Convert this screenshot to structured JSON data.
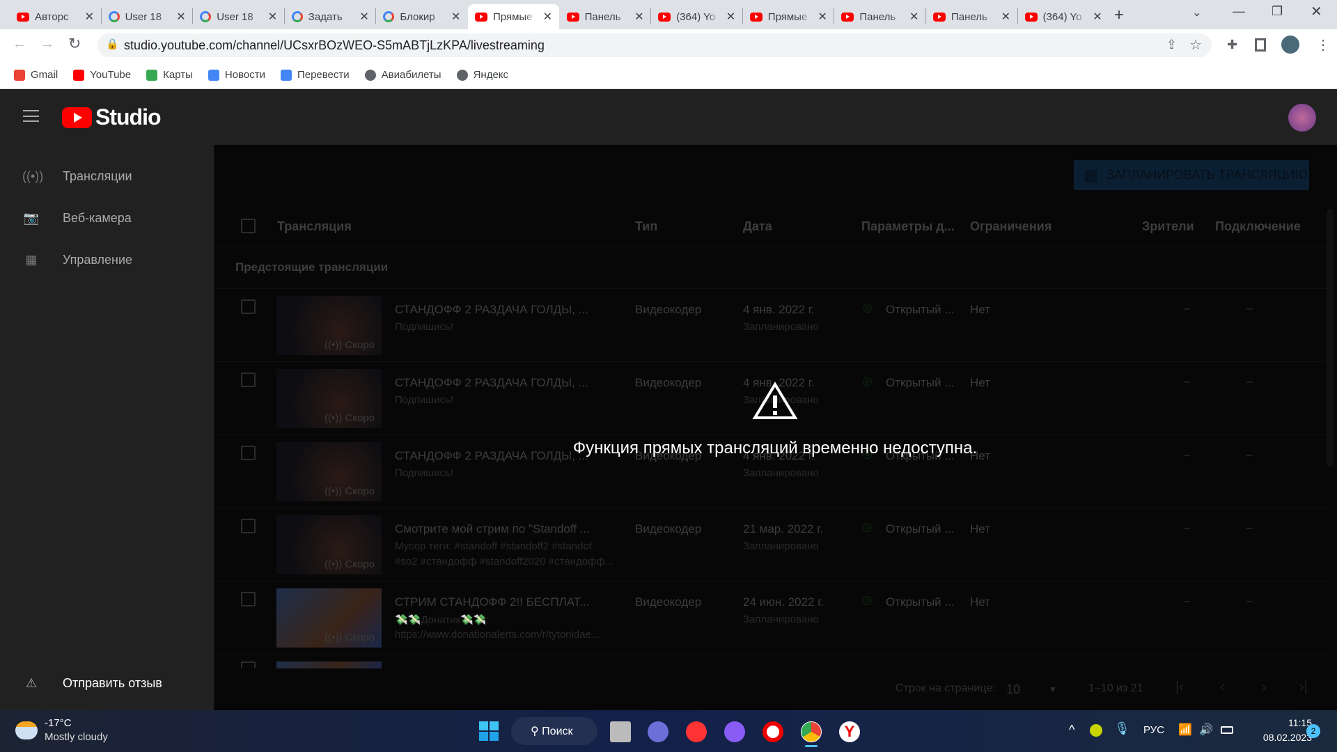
{
  "browser": {
    "tabs": [
      {
        "label": "Авторс",
        "icon": "youtube"
      },
      {
        "label": "User 18",
        "icon": "google"
      },
      {
        "label": "User 18",
        "icon": "google"
      },
      {
        "label": "Задать",
        "icon": "google"
      },
      {
        "label": "Блокир",
        "icon": "google"
      },
      {
        "label": "Прямые",
        "icon": "youtube",
        "active": true
      },
      {
        "label": "Панель",
        "icon": "youtube"
      },
      {
        "label": "(364) Yo",
        "icon": "youtube"
      },
      {
        "label": "Прямые",
        "icon": "youtube"
      },
      {
        "label": "Панель",
        "icon": "youtube"
      },
      {
        "label": "Панель",
        "icon": "youtube"
      },
      {
        "label": "(364) Yo",
        "icon": "youtube"
      }
    ],
    "url": "studio.youtube.com/channel/UCsxrBOzWEO-S5mABTjLzKPA/livestreaming",
    "bookmarks": [
      "Gmail",
      "YouTube",
      "Карты",
      "Новости",
      "Перевести",
      "Авиабилеты",
      "Яндекс"
    ]
  },
  "studio": {
    "logo_text": "Studio",
    "brand_color": "#ff0000"
  },
  "sidebar": {
    "items": [
      {
        "label": "Трансляции",
        "icon": "broadcast-icon"
      },
      {
        "label": "Веб-камера",
        "icon": "camera-icon"
      },
      {
        "label": "Управление",
        "icon": "calendar-icon"
      }
    ],
    "feedback": "Отправить отзыв"
  },
  "main": {
    "schedule_button": "ЗАПЛАНИРОВАТЬ ТРАНСЛЯЦИЮ",
    "columns": [
      "Трансляция",
      "Тип",
      "Дата",
      "Параметры д...",
      "Ограничения",
      "Зрители",
      "Подключение"
    ],
    "section": "Предстоящие трансляции",
    "rows": [
      {
        "title": "СТАНДОФФ 2 РАЗДАЧА ГОЛДЫ, ...",
        "desc": "Подпишись!",
        "desc2": "",
        "type": "Видеокодер",
        "date": "4 янв. 2022 г.",
        "status": "Запланировано",
        "visibility": "Открытый ...",
        "restrictions": "Нет",
        "viewers": "–",
        "connection": "–",
        "badge": "Скоро"
      },
      {
        "title": "СТАНДОФФ 2 РАЗДАЧА ГОЛДЫ, ...",
        "desc": "Подпишись!",
        "desc2": "",
        "type": "Видеокодер",
        "date": "4 янв. 2022 г.",
        "status": "Запланировано",
        "visibility": "Открытый ...",
        "restrictions": "Нет",
        "viewers": "–",
        "connection": "–",
        "badge": "Скоро"
      },
      {
        "title": "СТАНДОФФ 2 РАЗДАЧА ГОЛДЫ, ...",
        "desc": "Подпишись!",
        "desc2": "",
        "type": "Видеокодер",
        "date": "4 янв. 2022 г.",
        "status": "Запланировано",
        "visibility": "Открытый ...",
        "restrictions": "Нет",
        "viewers": "–",
        "connection": "–",
        "badge": "Скоро"
      },
      {
        "title": "Смотрите мой стрим по \"Standoff ...",
        "desc": "Мусор теги: #standoff #standoff2 #standof",
        "desc2": "#so2 #стандофф #standoff2020 #стандофф...",
        "type": "Видеокодер",
        "date": "21 мар. 2022 г.",
        "status": "Запланировано",
        "visibility": "Открытый ...",
        "restrictions": "Нет",
        "viewers": "–",
        "connection": "–",
        "badge": "Скоро"
      },
      {
        "title": "СТРИМ СТАНДОФФ 2!! БЕСПЛАТ...",
        "desc": "💸💸Донатик💸💸:",
        "desc2": "https://www.donationalerts.com/r/tytonidae...",
        "type": "Видеокодер",
        "date": "24 июн. 2022 г.",
        "status": "Запланировано",
        "visibility": "Открытый ...",
        "restrictions": "Нет",
        "viewers": "–",
        "connection": "–",
        "badge": "Скоро"
      }
    ],
    "pagination": {
      "rows_label": "Строк на странице:",
      "rows_value": "10",
      "range": "1–10 из 21"
    },
    "error_message": "Функция прямых трансляций временно недоступна."
  },
  "taskbar": {
    "weather_temp": "-17°C",
    "weather_desc": "Mostly cloudy",
    "search": "Поиск",
    "lang": "РУС",
    "time": "11:15",
    "date": "08.02.2023",
    "notifications": "2"
  }
}
